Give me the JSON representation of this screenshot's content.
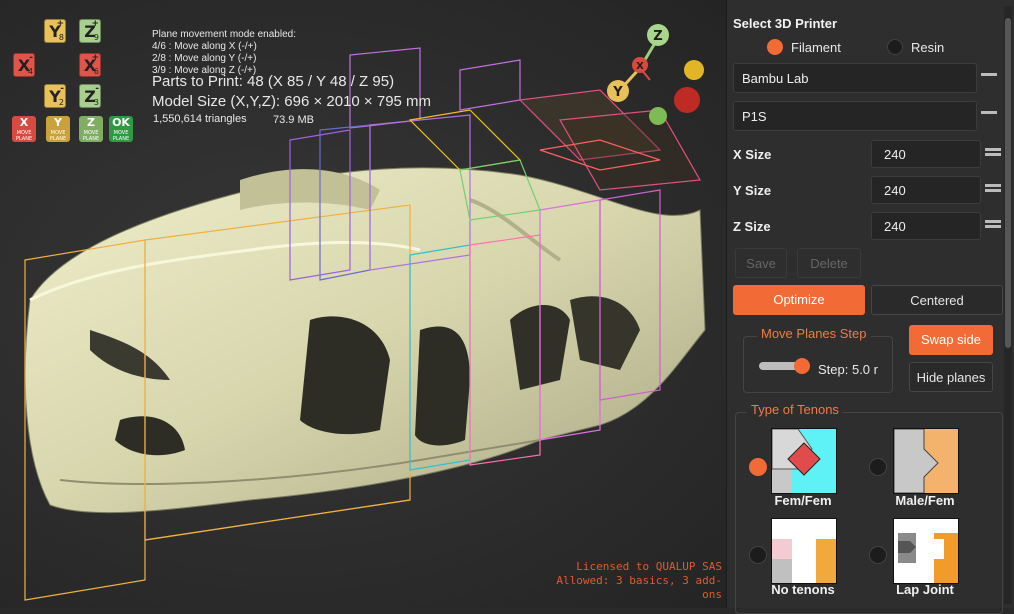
{
  "viewport": {
    "mode_lines": [
      "Plane movement mode enabled:",
      "4/6 : Move along X (-/+)",
      "2/8 : Move along Y (-/+)",
      "3/9 : Move along Z (-/+)"
    ],
    "parts_to_print": "Parts to Print: 48 (X 85 / Y 48 / Z 95)",
    "model_size": "Model Size (X,Y,Z): 696 × 2010 × 795 mm",
    "triangles": "1,550,614 triangles",
    "memory": "73.9 MB",
    "axis_buttons": {
      "y_plus": {
        "label": "Y",
        "sign": "+",
        "key": "8"
      },
      "z_plus": {
        "label": "Z",
        "sign": "+",
        "key": "9"
      },
      "x_minus": {
        "label": "X",
        "sign": "-",
        "key": "4"
      },
      "x_plus": {
        "label": "X",
        "sign": "+",
        "key": "6"
      },
      "y_minus": {
        "label": "Y",
        "sign": "-",
        "key": "2"
      },
      "z_minus": {
        "label": "Z",
        "sign": "-",
        "key": "3"
      }
    },
    "mode_buttons": {
      "x": {
        "label": "X",
        "sub": "MOVE PLANE"
      },
      "y": {
        "label": "Y",
        "sub": "MOVE PLANE"
      },
      "z": {
        "label": "Z",
        "sub": "MOVE PLANE"
      },
      "ok": {
        "label": "OK",
        "sub": "MOVE PLANE"
      }
    },
    "gizmo": {
      "x": "X",
      "y": "Y",
      "z": "Z"
    },
    "license_line1": "Licensed to QUALUP SAS",
    "license_line2": "Allowed: 3 basics, 3 add-ons"
  },
  "panel": {
    "title": "Select 3D  Printer",
    "radio_filament": "Filament",
    "radio_resin": "Resin",
    "brand": "Bambu Lab",
    "model": "P1S",
    "x_label": "X Size",
    "x_value": "240",
    "y_label": "Y Size",
    "y_value": "240",
    "z_label": "Z Size",
    "z_value": "240",
    "save": "Save",
    "delete": "Delete",
    "optimize": "Optimize",
    "centered": "Centered",
    "move_planes_title": "Move Planes Step",
    "step_value": "Step: 5.0 r",
    "swap_side": "Swap side",
    "hide_planes": "Hide planes",
    "tenons_title": "Type of Tenons",
    "tenons": [
      "Fem/Fem",
      "Male/Fem",
      "No tenons",
      "Lap Joint"
    ]
  },
  "colors": {
    "accent": "#f26a35",
    "axis_x": "#e2544a",
    "axis_y": "#e8c15a",
    "axis_z": "#a9cf8e"
  }
}
